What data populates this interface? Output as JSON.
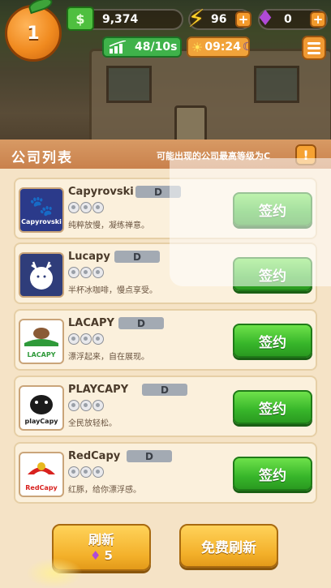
{
  "hud": {
    "level": "1",
    "money": "9,374",
    "energy": "96",
    "gems": "0",
    "rate": "48/10s",
    "time": "09:24"
  },
  "icons": {
    "level": "orange-icon",
    "money": "cash-icon",
    "energy": "lightning-icon",
    "gems": "gem-icon",
    "rate": "growth-chart-icon",
    "time_day": "sun-icon",
    "time_night": "moon-icon",
    "menu": "menu-icon",
    "hint": "exclamation-icon"
  },
  "panel": {
    "title": "公司列表",
    "hint": "可能出现的公司最高等级为C",
    "hint_button": "!"
  },
  "companies": [
    {
      "name": "Capyrovski",
      "logo_text": "Capyrovski",
      "grade": "D",
      "slogan": "纯粹放慢，凝练禅意。",
      "action": "签约",
      "stars": 3,
      "logo_bg": "#2b3a8a"
    },
    {
      "name": "Lucapy",
      "logo_text": "",
      "grade": "D",
      "slogan": "半杯冰咖啡，慢点享受。",
      "action": "签约",
      "stars": 3,
      "logo_bg": "#2f3d7a"
    },
    {
      "name": "LACAPY",
      "logo_text": "LACAPY",
      "grade": "D",
      "slogan": "漂浮起来，自在展现。",
      "action": "签约",
      "stars": 3,
      "logo_bg": "#ffffff"
    },
    {
      "name": "PLAYCAPY",
      "logo_text": "playCapy",
      "grade": "D",
      "slogan": "全民放轻松。",
      "action": "签约",
      "stars": 3,
      "logo_bg": "#ffffff"
    },
    {
      "name": "RedCapy",
      "logo_text": "RedCapy",
      "grade": "D",
      "slogan": "红豚，给你漂浮感。",
      "action": "签约",
      "stars": 3,
      "logo_bg": "#ffffff"
    }
  ],
  "footer": {
    "refresh_label": "刷新",
    "refresh_cost": "5",
    "free_refresh_label": "免费刷新"
  },
  "colors": {
    "accent_green": "#37b52a",
    "accent_orange": "#f3b02a",
    "panel_bg": "#f5e3c6",
    "grade_bg": "#a3aab3"
  }
}
